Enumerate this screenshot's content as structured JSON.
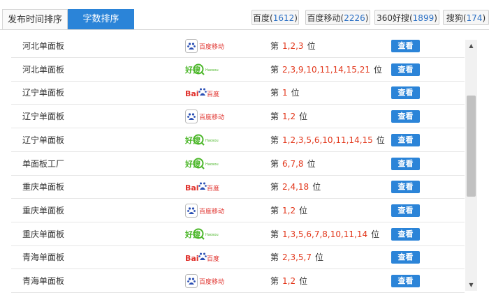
{
  "tabs": {
    "time_sort": "发布时间排序",
    "count_sort": "字数排序"
  },
  "engines": [
    {
      "label": "百度",
      "count": "1612"
    },
    {
      "label": "百度移动",
      "count": "2226"
    },
    {
      "label": "360好搜",
      "count": "1899"
    },
    {
      "label": "搜狗",
      "count": "174"
    }
  ],
  "rank_prefix": "第",
  "rank_suffix": "位",
  "button_label": "查看",
  "logo_text": {
    "baidu_mobile": "百度移动",
    "haosou": "好搜",
    "haosou_small": "Haosou",
    "baidu_bai": "Bai",
    "baidu_du": "百度"
  },
  "rows": [
    {
      "keyword": "河北单面板",
      "engine": "baidu-mobile",
      "positions": "1,2,3"
    },
    {
      "keyword": "河北单面板",
      "engine": "haosou",
      "positions": "2,3,9,10,11,14,15,21"
    },
    {
      "keyword": "辽宁单面板",
      "engine": "baidu",
      "positions": "1"
    },
    {
      "keyword": "辽宁单面板",
      "engine": "baidu-mobile",
      "positions": "1,2"
    },
    {
      "keyword": "辽宁单面板",
      "engine": "haosou",
      "positions": "1,2,3,5,6,10,11,14,15"
    },
    {
      "keyword": "单面板工厂",
      "engine": "haosou",
      "positions": "6,7,8"
    },
    {
      "keyword": "重庆单面板",
      "engine": "baidu",
      "positions": "2,4,18"
    },
    {
      "keyword": "重庆单面板",
      "engine": "baidu-mobile",
      "positions": "1,2"
    },
    {
      "keyword": "重庆单面板",
      "engine": "haosou",
      "positions": "1,3,5,6,7,8,10,11,14"
    },
    {
      "keyword": "青海单面板",
      "engine": "baidu",
      "positions": "2,3,5,7"
    },
    {
      "keyword": "青海单面板",
      "engine": "baidu-mobile",
      "positions": "1,2"
    }
  ],
  "colors": {
    "accent": "#2b84d8",
    "rank_numbers": "#e2361a",
    "count": "#2a6fc4"
  },
  "icons": {
    "scroll_up": "▲",
    "scroll_down": "▼"
  }
}
